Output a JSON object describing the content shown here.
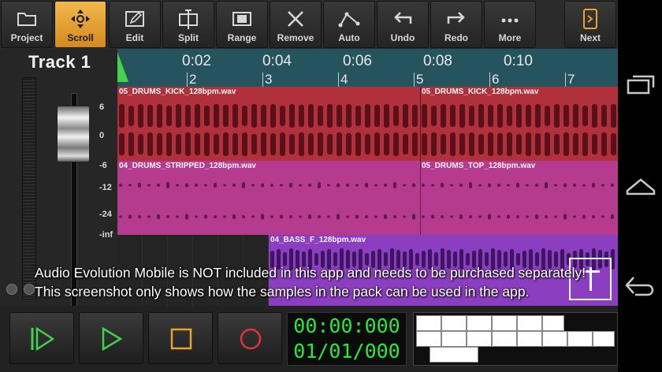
{
  "toolbar": {
    "buttons": [
      {
        "label": "Project",
        "icon": "folder-icon"
      },
      {
        "label": "Scroll",
        "icon": "move-arrows-icon",
        "active": true
      },
      {
        "label": "Edit",
        "icon": "edit-pencil-icon"
      },
      {
        "label": "Split",
        "icon": "split-icon"
      },
      {
        "label": "Range",
        "icon": "range-icon"
      },
      {
        "label": "Remove",
        "icon": "close-x-icon"
      },
      {
        "label": "Auto",
        "icon": "automation-icon"
      },
      {
        "label": "Undo",
        "icon": "undo-arrow-icon"
      },
      {
        "label": "Redo",
        "icon": "redo-arrow-icon"
      },
      {
        "label": "More",
        "icon": "more-dots-icon"
      },
      {
        "label": "Next",
        "icon": "next-page-icon"
      }
    ],
    "active_color": "#e6a232"
  },
  "track": {
    "title": "Track 1",
    "db_labels": [
      "6",
      "0",
      "-6",
      "-12",
      "-24",
      "-inf"
    ]
  },
  "timeline": {
    "times": [
      "0:02",
      "0:04",
      "0:06",
      "0:08",
      "0:10"
    ],
    "bars": [
      "2",
      "3",
      "4",
      "5",
      "6",
      "7"
    ]
  },
  "clips": {
    "lane1_a": "05_DRUMS_KICK_128bpm.wav",
    "lane1_b": "05_DRUMS_KICK_128bpm.wav",
    "lane2_a": "04_DRUMS_STRIPPED_128bpm.wav",
    "lane2_b": "05_DRUMS_TOP_128bpm.wav",
    "lane3_a": "04_BASS_F_128bpm.wav"
  },
  "colors": {
    "drums_kick": "#b0303b",
    "drums_top": "#b53b8e",
    "bass": "#8c3ec0",
    "timeline": "#25545e",
    "counter": "#20ee3a"
  },
  "notice": {
    "line1": "Audio Evolution Mobile is NOT included in this app and needs to be purchased separately!",
    "line2": "This screenshot only shows how the samples in the pack can be used in the app."
  },
  "transport": {
    "buttons": [
      "rewind-icon",
      "play-icon",
      "stop-icon",
      "record-icon"
    ],
    "time": "00:00:000",
    "position": "01/01/000"
  },
  "sysnav": [
    "recent-apps-icon",
    "home-icon",
    "back-icon"
  ]
}
